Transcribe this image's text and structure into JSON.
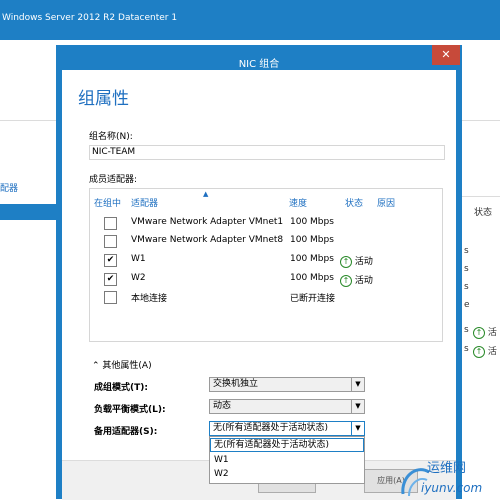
{
  "background_window": {
    "title": "Windows Server 2012 R2 Datacenter   1",
    "left_tab": "配器",
    "right_header": "状态",
    "right_fragments": [
      "s",
      "s",
      "s",
      "e",
      "s",
      "s"
    ],
    "right_status": [
      {
        "icon": "arrow-up-icon",
        "text": "活"
      },
      {
        "icon": "arrow-up-icon",
        "text": "活"
      }
    ]
  },
  "dialog": {
    "title": "NIC 组合",
    "close_label": "✕",
    "heading": "组属性",
    "team_name_label": "组名称(N):",
    "team_name_value": "NIC-TEAM",
    "members_label": "成员适配器:",
    "columns": [
      "在组中",
      "适配器",
      "速度",
      "状态",
      "原因"
    ],
    "adapters": [
      {
        "in_team": false,
        "name": "VMware Network Adapter VMnet1",
        "speed": "100 Mbps",
        "status": ""
      },
      {
        "in_team": false,
        "name": "VMware Network Adapter VMnet8",
        "speed": "100 Mbps",
        "status": ""
      },
      {
        "in_team": true,
        "name": "W1",
        "speed": "100 Mbps",
        "status": "活动"
      },
      {
        "in_team": true,
        "name": "W2",
        "speed": "100 Mbps",
        "status": "活动"
      },
      {
        "in_team": false,
        "name": "本地连接",
        "speed": "已断开连接",
        "status": ""
      }
    ],
    "other_props_label": "其他属性(A)",
    "teaming_mode_label": "成组模式(T):",
    "teaming_mode_value": "交换机独立",
    "lb_mode_label": "负载平衡模式(L):",
    "lb_mode_value": "动态",
    "standby_label": "备用适配器(S):",
    "standby_value": "无(所有适配器处于活动状态)",
    "standby_options": [
      "无(所有适配器处于活动状态)",
      "W1",
      "W2"
    ],
    "apply_fragment": "应用(A)"
  },
  "watermark": {
    "line1": "运维网",
    "line2": "iyunv.com"
  },
  "colors": {
    "accent": "#1e7fc5",
    "active_green": "#2a8a2a",
    "close_red": "#c74a3a"
  }
}
